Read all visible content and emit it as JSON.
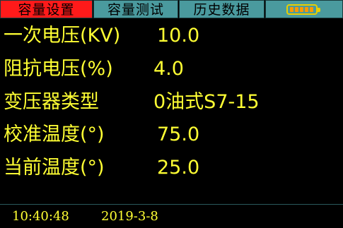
{
  "tabs": [
    {
      "label": "容量设置",
      "active": true
    },
    {
      "label": "容量测试",
      "active": false
    },
    {
      "label": "历史数据",
      "active": false
    }
  ],
  "battery": {
    "icon": "battery-icon",
    "level": 1.0,
    "color": "#ff9900"
  },
  "rows": [
    {
      "label": "一次电压(KV)",
      "value": "10.0"
    },
    {
      "label": "阻抗电压(%)",
      "value": "4.0"
    },
    {
      "label": "变压器类型",
      "value": "0油式S7-15"
    },
    {
      "label": "校准温度(°)",
      "value": "75.0"
    },
    {
      "label": "当前温度(°)",
      "value": "25.0"
    }
  ],
  "status": {
    "time": "10:40:48",
    "date": "2019-3-8"
  },
  "colors": {
    "accent": "#ff1a1a",
    "tab": "#4a9a9e",
    "text": "#ffff33",
    "background": "#000000"
  }
}
